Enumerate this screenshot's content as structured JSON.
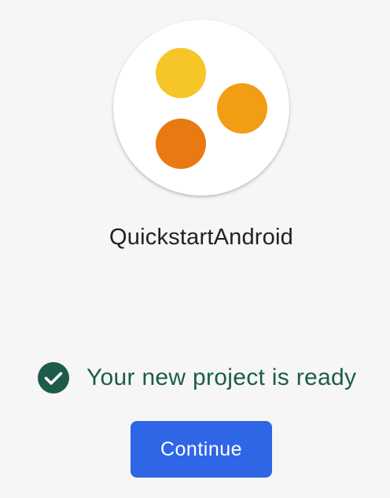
{
  "project": {
    "name": "QuickstartAndroid",
    "logo": {
      "icon": "three-dots-logo",
      "dot_colors": [
        "#f6c527",
        "#f29d13",
        "#e87a11"
      ]
    }
  },
  "status": {
    "icon": "check-circle-icon",
    "text": "Your new project is ready",
    "color": "#1e5b4a"
  },
  "actions": {
    "continue_label": "Continue",
    "continue_color": "#2f66e6"
  }
}
